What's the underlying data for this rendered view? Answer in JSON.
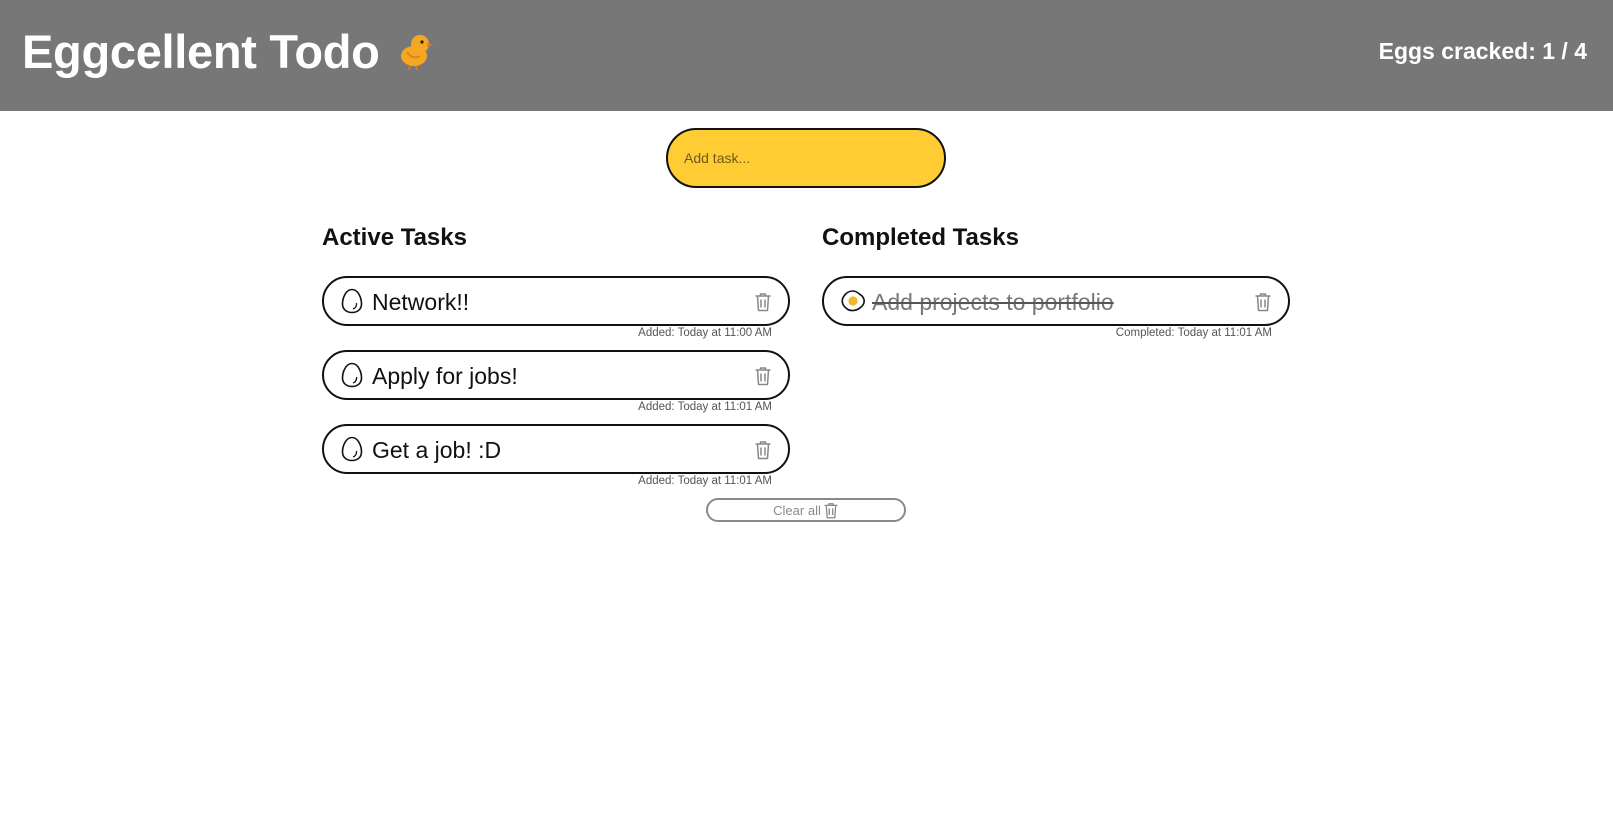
{
  "header": {
    "title": "Eggcellent Todo",
    "icon": "chick-icon",
    "counter_label": "Eggs cracked: 1 / 4"
  },
  "input": {
    "placeholder": "Add task...",
    "value": ""
  },
  "active": {
    "title": "Active Tasks",
    "tasks": [
      {
        "label": "Network!!",
        "meta": "Added: Today at 11:00 AM"
      },
      {
        "label": "Apply for jobs!",
        "meta": "Added: Today at 11:01 AM"
      },
      {
        "label": "Get a job! :D",
        "meta": "Added: Today at 11:01 AM"
      }
    ]
  },
  "completed": {
    "title": "Completed Tasks",
    "tasks": [
      {
        "label": "Add projects to portfolio",
        "meta": "Completed: Today at 11:01 AM"
      }
    ]
  },
  "clear_all": {
    "label": "Clear all"
  },
  "colors": {
    "header_bg": "#777777",
    "accent_yellow": "#ffcc33",
    "yolk": "#f7b52c"
  }
}
